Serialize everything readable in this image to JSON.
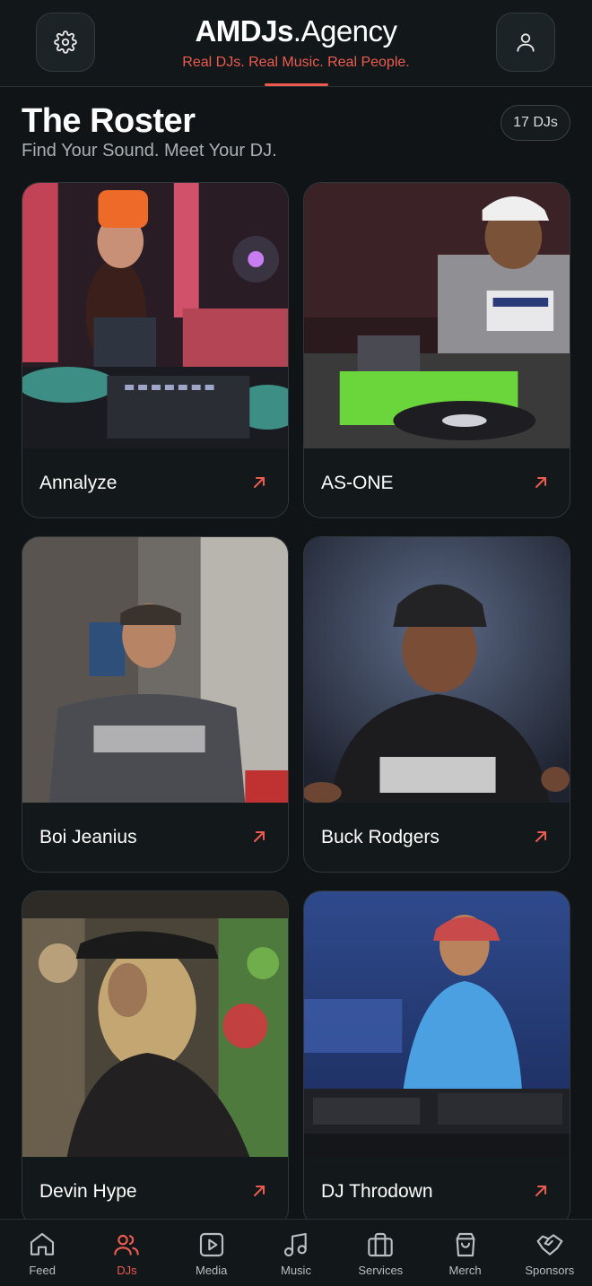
{
  "header": {
    "brand_bold": "AMDJs",
    "brand_rest": ".Agency",
    "tagline": "Real DJs. Real Music. Real People.",
    "settings_icon": "gear-icon",
    "profile_icon": "user-icon"
  },
  "roster": {
    "title": "The Roster",
    "subtitle": "Find Your Sound. Meet Your DJ.",
    "count": "17 DJs"
  },
  "djs": [
    {
      "name": "Annalyze"
    },
    {
      "name": "AS-ONE"
    },
    {
      "name": "Boi Jeanius"
    },
    {
      "name": "Buck Rodgers"
    },
    {
      "name": "Devin Hype"
    },
    {
      "name": "DJ Throdown"
    }
  ],
  "nav": [
    {
      "label": "Feed",
      "icon": "home-icon"
    },
    {
      "label": "DJs",
      "icon": "users-icon",
      "active": true
    },
    {
      "label": "Media",
      "icon": "play-icon"
    },
    {
      "label": "Music",
      "icon": "music-note-icon"
    },
    {
      "label": "Services",
      "icon": "briefcase-icon"
    },
    {
      "label": "Merch",
      "icon": "shopping-bag-icon"
    },
    {
      "label": "Sponsors",
      "icon": "handshake-icon"
    }
  ],
  "colors": {
    "accent": "#ee5b4f",
    "background": "#101416",
    "card": "#13181a"
  }
}
